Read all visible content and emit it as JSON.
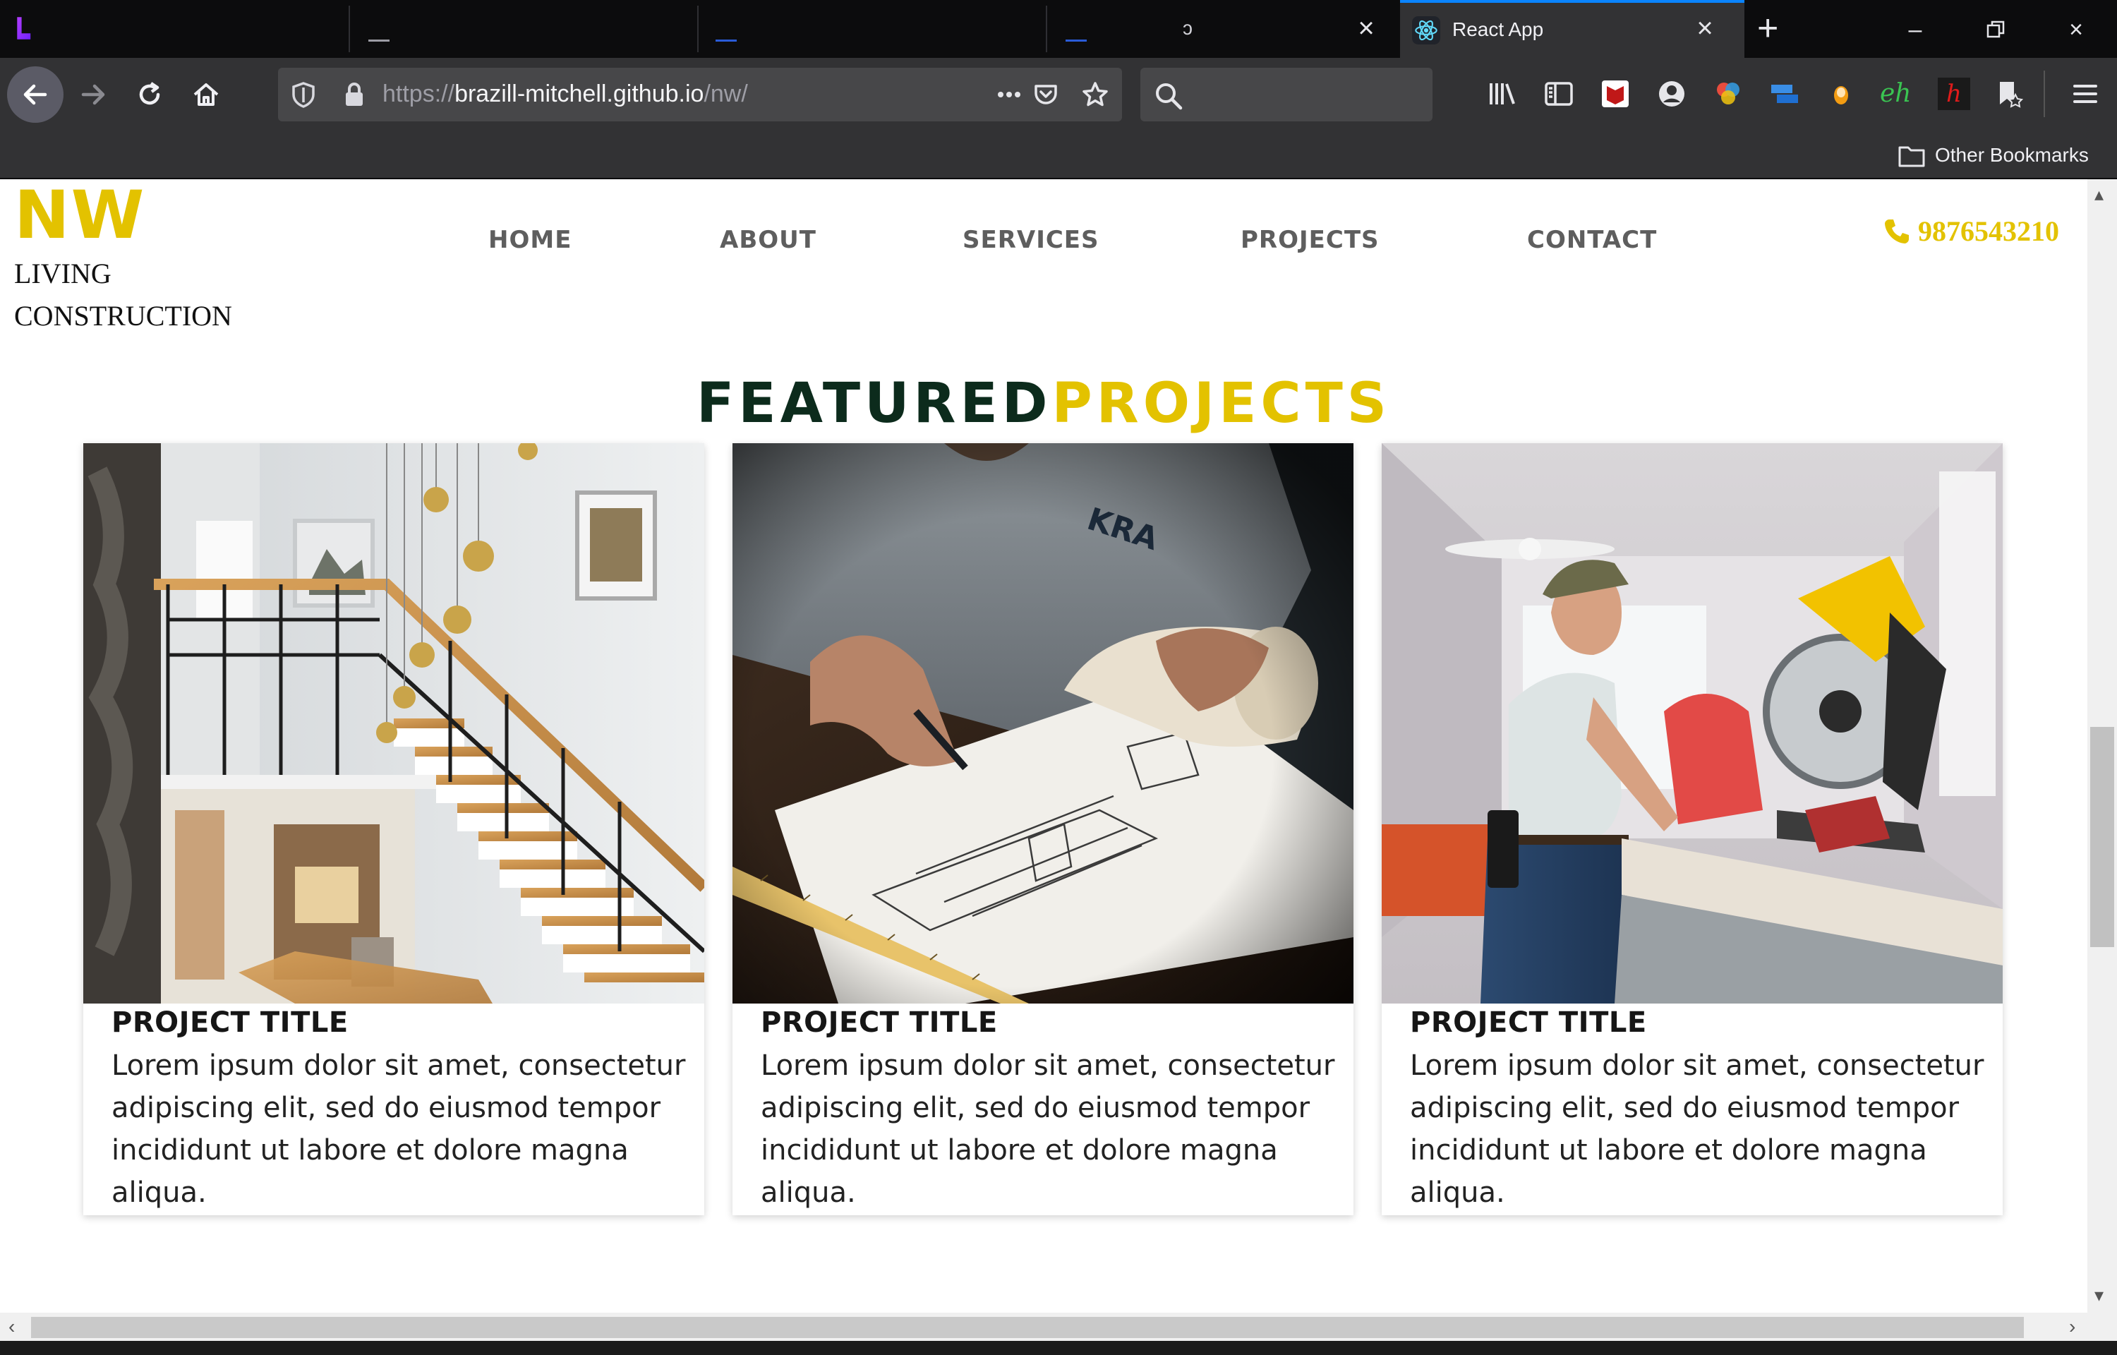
{
  "browser": {
    "active_tab_title": "React App",
    "inactive_tab_glyph": "ↄ",
    "url_scheme": "https://",
    "url_host": "brazill-mitchell.github.io",
    "url_path": "/nw/",
    "bookmark_folder": "Other Bookmarks",
    "accent": "#0a84ff",
    "icons": [
      "back-arrow-icon",
      "forward-arrow-icon",
      "reload-icon",
      "home-icon",
      "shield-icon",
      "lock-icon",
      "more-icon",
      "pocket-icon",
      "star-icon",
      "search-icon",
      "library-icon",
      "sidebar-icon",
      "mcafee-icon",
      "account-icon",
      "color-picker-icon",
      "extension-icon",
      "extension-icon",
      "eh-icon",
      "h-icon",
      "bookmark-icon",
      "menu-icon",
      "folder-icon"
    ],
    "toolbar_labels": {
      "eh": "eh",
      "h": "h"
    }
  },
  "site": {
    "brand": {
      "logo": "NW",
      "line1": "LIVING",
      "line2": "CONSTRUCTION",
      "color": "#e3c200"
    },
    "nav": [
      "HOME",
      "ABOUT",
      "SERVICES",
      "PROJECTS",
      "CONTACT"
    ],
    "phone": "9876543210",
    "section_title": {
      "part1": "FEATURED",
      "part2": "PROJECTS"
    },
    "projects": [
      {
        "title": "PROJECT TITLE",
        "text": "Lorem ipsum dolor sit amet, consectetur adipiscing elit, sed do eiusmod tempor incididunt ut labore et dolore magna aliqua."
      },
      {
        "title": "PROJECT TITLE",
        "text": "Lorem ipsum dolor sit amet, consectetur adipiscing elit, sed do eiusmod tempor incididunt ut labore et dolore magna aliqua."
      },
      {
        "title": "PROJECT TITLE",
        "text": "Lorem ipsum dolor sit amet, consectetur adipiscing elit, sed do eiusmod tempor incididunt ut labore et dolore magna aliqua."
      }
    ]
  }
}
